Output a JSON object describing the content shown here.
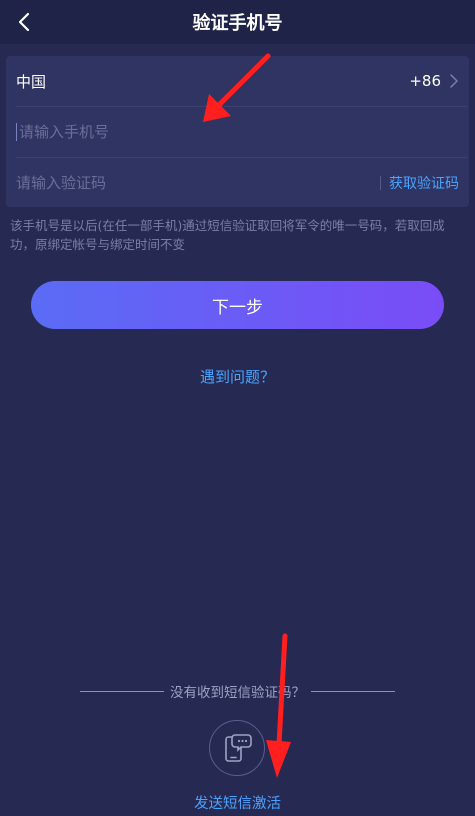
{
  "header": {
    "title": "验证手机号"
  },
  "form": {
    "country_name": "中国",
    "country_code": "+86",
    "phone_placeholder": "请输入手机号",
    "code_placeholder": "请输入验证码",
    "get_code_label": "获取验证码"
  },
  "hint": "该手机号是以后(在任一部手机)通过短信验证取回将军令的唯一号码，若取回成功，原绑定帐号与绑定时间不变",
  "next_button_label": "下一步",
  "problem_link": "遇到问题？",
  "sms_section": {
    "prompt": "没有收到短信验证码？",
    "send_label": "发送短信激活"
  },
  "colors": {
    "background": "#262a52",
    "accent": "#4ba3ff",
    "button_gradient_start": "#5a6cf5",
    "button_gradient_end": "#7a4cf7",
    "annotation_arrow": "#ff1f1f"
  },
  "icons": {
    "back": "chevron-left-icon",
    "country_select": "chevron-right-icon",
    "sms": "phone-message-icon"
  }
}
